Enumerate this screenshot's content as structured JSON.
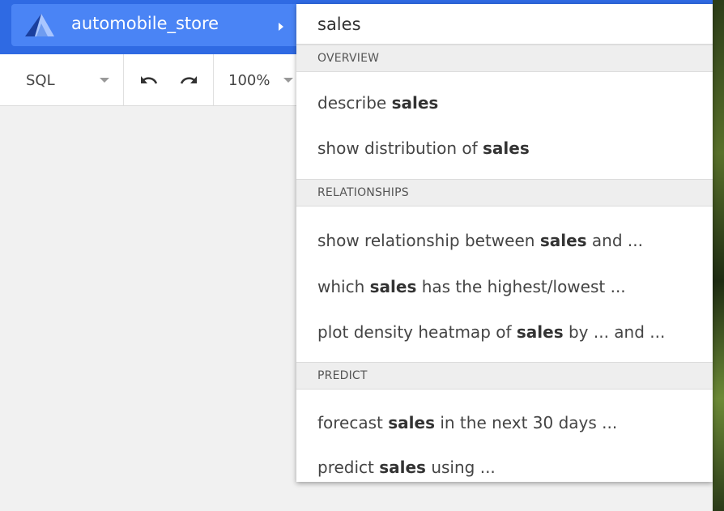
{
  "app": {
    "datasource_name": "automobile_store",
    "logo_icon": "triangle-sail-logo-icon",
    "accent": "#2f6ae3"
  },
  "toolbar": {
    "language": "SQL",
    "undo_icon": "undo-icon",
    "redo_icon": "redo-icon",
    "zoom": "100%"
  },
  "search": {
    "value": "sales"
  },
  "sections": [
    {
      "header": "OVERVIEW",
      "items": [
        {
          "pre": "describe ",
          "bold": "sales",
          "post": ""
        },
        {
          "pre": "show distribution of ",
          "bold": "sales",
          "post": ""
        }
      ]
    },
    {
      "header": "RELATIONSHIPS",
      "items": [
        {
          "pre": "show relationship between ",
          "bold": "sales",
          "post": " and ..."
        },
        {
          "pre": "which ",
          "bold": "sales",
          "post": " has the highest/lowest ..."
        },
        {
          "pre": "plot density heatmap of ",
          "bold": "sales",
          "post": " by ... and ..."
        }
      ]
    },
    {
      "header": "PREDICT",
      "items": [
        {
          "pre": "forecast ",
          "bold": "sales",
          "post": " in the next 30 days ..."
        },
        {
          "pre": "predict ",
          "bold": "sales",
          "post": " using ..."
        }
      ]
    }
  ]
}
